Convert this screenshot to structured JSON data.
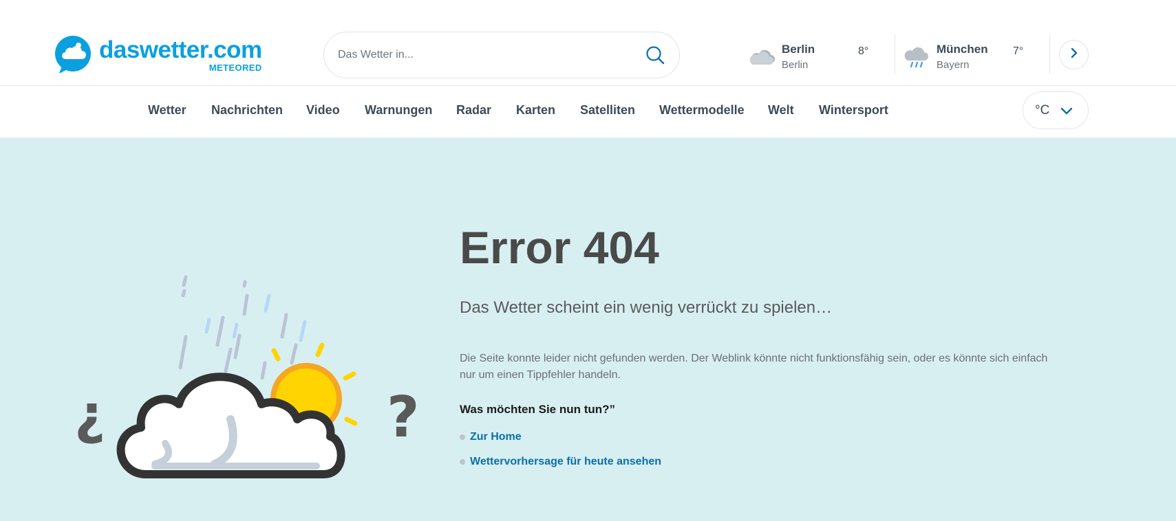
{
  "header": {
    "logo": {
      "name": "daswetter.com",
      "sub": "METEORED"
    },
    "search": {
      "placeholder": "Das Wetter in..."
    },
    "cities": [
      {
        "name": "Berlin",
        "region": "Berlin",
        "temp": "8°",
        "icon": "cloudy-icon"
      },
      {
        "name": "München",
        "region": "Bayern",
        "temp": "7°",
        "icon": "rain-cloud-icon"
      }
    ]
  },
  "nav": {
    "items": [
      "Wetter",
      "Nachrichten",
      "Video",
      "Warnungen",
      "Radar",
      "Karten",
      "Satelliten",
      "Wettermodelle",
      "Welt",
      "Wintersport"
    ],
    "unit": "°C"
  },
  "error": {
    "title": "Error 404",
    "subtitle": "Das Wetter scheint ein wenig verrückt zu spielen…",
    "description": "Die Seite konnte leider nicht gefunden werden. Der Weblink könnte nicht funktionsfähig sein, oder es könnte sich einfach nur um einen Tippfehler handeln.",
    "question": "Was möchten Sie nun tun?”",
    "links": [
      "Zur Home",
      "Wettervorhersage für heute ansehen"
    ]
  },
  "colors": {
    "brand": "#0aa0e0",
    "link": "#0a6fa8",
    "main_bg": "#d8eff2",
    "sun": "#ffd400"
  }
}
